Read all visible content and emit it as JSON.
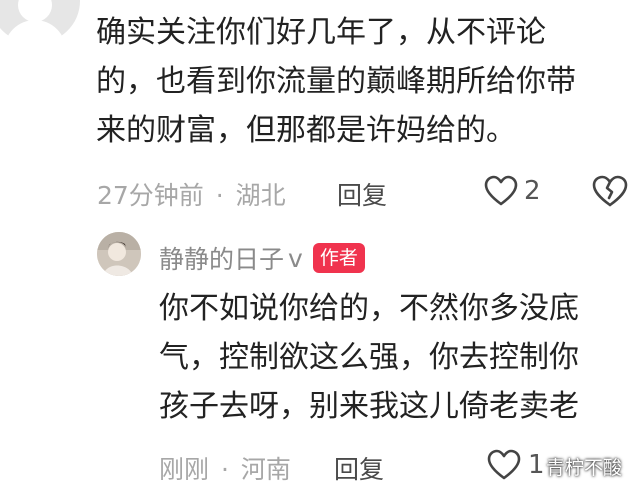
{
  "comment": {
    "lines": [
      "确实关注你们好几年了，从不评论",
      "的，也看到你流量的巅峰期所给你带",
      "来的财富，但那都是许妈给的。"
    ],
    "time": "27分钟前",
    "separator": "·",
    "location": "湖北",
    "reply_label": "回复",
    "like_count": "2"
  },
  "reply": {
    "username": "静静的日子",
    "verified_mark": "v",
    "author_badge": "作者",
    "lines": [
      "你不如说你给的，不然你多没底",
      "气，控制欲这么强，你去控制你",
      "孩子去呀，别来我这儿倚老卖老"
    ],
    "time": "刚刚",
    "separator": "·",
    "location": "河南",
    "reply_label": "回复",
    "like_count": "1"
  },
  "watermark": "青柠不酸",
  "icons": {
    "like": "heart-outline-icon",
    "dislike": "broken-heart-icon"
  },
  "colors": {
    "badge": "#f0334e",
    "meta": "#a7a7a7",
    "text": "#222222"
  }
}
